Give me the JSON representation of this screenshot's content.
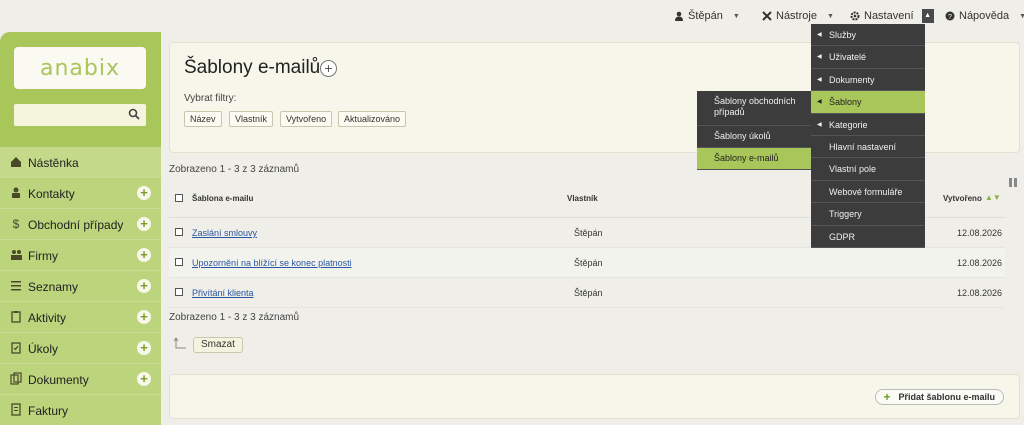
{
  "topbar": {
    "user": "Štěpán",
    "tools": "Nástroje",
    "settings": "Nastavení",
    "help": "Nápověda"
  },
  "sidebar": {
    "logo": "anabix",
    "search_placeholder": "",
    "items": [
      {
        "label": "Nástěnka",
        "icon": "home-icon",
        "has_add": false
      },
      {
        "label": "Kontakty",
        "icon": "person-icon",
        "has_add": true
      },
      {
        "label": "Obchodní případy",
        "icon": "dollar-icon",
        "has_add": true
      },
      {
        "label": "Firmy",
        "icon": "people-icon",
        "has_add": true
      },
      {
        "label": "Seznamy",
        "icon": "list-icon",
        "has_add": true
      },
      {
        "label": "Aktivity",
        "icon": "clipboard-icon",
        "has_add": true
      },
      {
        "label": "Úkoly",
        "icon": "checklist-icon",
        "has_add": true
      },
      {
        "label": "Dokumenty",
        "icon": "documents-icon",
        "has_add": true
      },
      {
        "label": "Faktury",
        "icon": "invoice-icon",
        "has_add": false
      }
    ]
  },
  "page": {
    "title": "Šablony e-mailů",
    "filter_label": "Vybrat filtry:",
    "filters": [
      "Název",
      "Vlastník",
      "Vytvořeno",
      "Aktualizováno"
    ],
    "count_text": "Zobrazeno 1 - 3 z 3 záznamů"
  },
  "table": {
    "columns": {
      "name": "Šablona e-mailu",
      "owner": "Vlastník",
      "created": "Vytvořeno"
    },
    "rows": [
      {
        "name": "Zaslání smlouvy",
        "owner": "Štěpán",
        "created": "12.08.2026"
      },
      {
        "name": "Upozornění na blížící se konec platnosti",
        "owner": "Štěpán",
        "created": "12.08.2026"
      },
      {
        "name": "Přivítání klienta",
        "owner": "Štěpán",
        "created": "12.08.2026"
      }
    ]
  },
  "actions": {
    "delete": "Smazat",
    "add_template": "Přidat šablonu e-mailu"
  },
  "settings_menu": [
    {
      "label": "Služby",
      "arrow": true,
      "active": false
    },
    {
      "label": "Uživatelé",
      "arrow": true,
      "active": false
    },
    {
      "label": "Dokumenty",
      "arrow": true,
      "active": false
    },
    {
      "label": "Šablony",
      "arrow": true,
      "active": true
    },
    {
      "label": "Kategorie",
      "arrow": true,
      "active": false
    },
    {
      "label": "Hlavní nastavení",
      "arrow": false,
      "active": false
    },
    {
      "label": "Vlastní pole",
      "arrow": false,
      "active": false
    },
    {
      "label": "Webové formuláře",
      "arrow": false,
      "active": false
    },
    {
      "label": "Triggery",
      "arrow": false,
      "active": false
    },
    {
      "label": "GDPR",
      "arrow": false,
      "active": false
    }
  ],
  "templates_submenu": [
    {
      "label": "Šablony obchodních případů",
      "active": false
    },
    {
      "label": "Šablony úkolů",
      "active": false
    },
    {
      "label": "Šablony e-mailů",
      "active": true
    }
  ],
  "colors": {
    "sidebar": "#a8c65a",
    "accent": "#a8c65a",
    "menu_bg": "#3c3c3c",
    "link": "#2a56a0"
  }
}
